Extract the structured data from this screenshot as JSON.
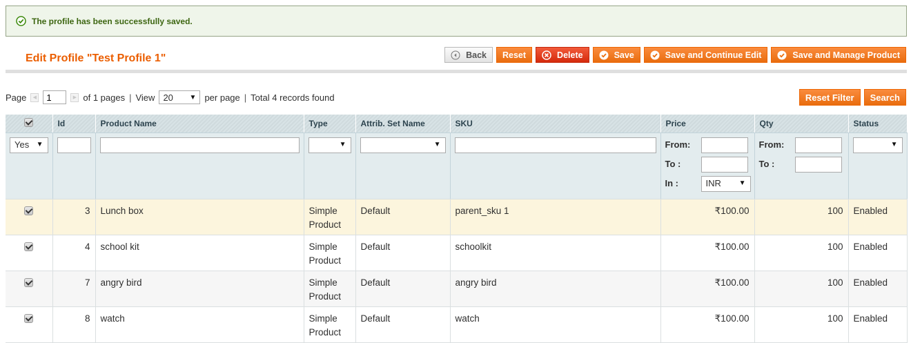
{
  "message": {
    "text": "The profile has been successfully saved."
  },
  "page_title": "Edit Profile \"Test Profile 1\"",
  "toolbar": {
    "back_label": "Back",
    "reset_label": "Reset",
    "delete_label": "Delete",
    "save_label": "Save",
    "save_continue_label": "Save and Continue Edit",
    "save_manage_label": "Save and Manage Product"
  },
  "pager": {
    "page_label": "Page",
    "page_value": "1",
    "of_pages": "of 1 pages",
    "sep": "|",
    "view_label": "View",
    "view_value": "20",
    "per_page": "per page",
    "total": "Total 4 records found"
  },
  "filter_buttons": {
    "reset_filter": "Reset Filter",
    "search": "Search"
  },
  "columns": {
    "id": "Id",
    "name": "Product Name",
    "type": "Type",
    "attrib": "Attrib. Set Name",
    "sku": "SKU",
    "price": "Price",
    "qty": "Qty",
    "status": "Status"
  },
  "filters": {
    "in_products": "Yes",
    "from_label": "From:",
    "to_label": "To :",
    "in_label": "In :",
    "currency": "INR"
  },
  "rows": [
    {
      "id": "3",
      "name": "Lunch box",
      "type": "Simple Product",
      "attrib": "Default",
      "sku": "parent_sku 1",
      "price": "₹100.00",
      "qty": "100",
      "status": "Enabled"
    },
    {
      "id": "4",
      "name": "school kit",
      "type": "Simple Product",
      "attrib": "Default",
      "sku": "schoolkit",
      "price": "₹100.00",
      "qty": "100",
      "status": "Enabled"
    },
    {
      "id": "7",
      "name": "angry bird",
      "type": "Simple Product",
      "attrib": "Default",
      "sku": "angry bird",
      "price": "₹100.00",
      "qty": "100",
      "status": "Enabled"
    },
    {
      "id": "8",
      "name": "watch",
      "type": "Simple Product",
      "attrib": "Default",
      "sku": "watch",
      "price": "₹100.00",
      "qty": "100",
      "status": "Enabled"
    }
  ],
  "colors": {
    "accent": "#eb5e00",
    "button": "#f18200",
    "delete": "#d52a0d",
    "success_text": "#3d6611"
  }
}
